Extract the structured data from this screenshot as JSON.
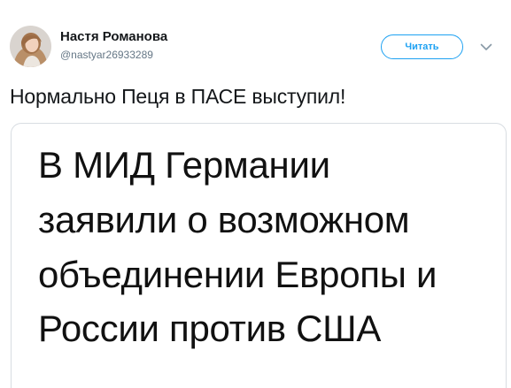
{
  "tweet": {
    "author": {
      "display_name": "Настя Романова",
      "handle": "@nastyar26933289",
      "avatar_icon": "user-avatar"
    },
    "follow_button_label": "Читать",
    "menu_icon": "chevron-down-icon",
    "text": "Нормально Пеця в ПАСЕ выступил!",
    "media": {
      "lines": [
        "В МИД Германии",
        "заявили о возможном",
        "объединении Европы и",
        "России против США"
      ]
    }
  },
  "colors": {
    "accent": "#1da1f2",
    "text_primary": "#14171a",
    "text_secondary": "#657786",
    "border": "#d8dde2"
  }
}
